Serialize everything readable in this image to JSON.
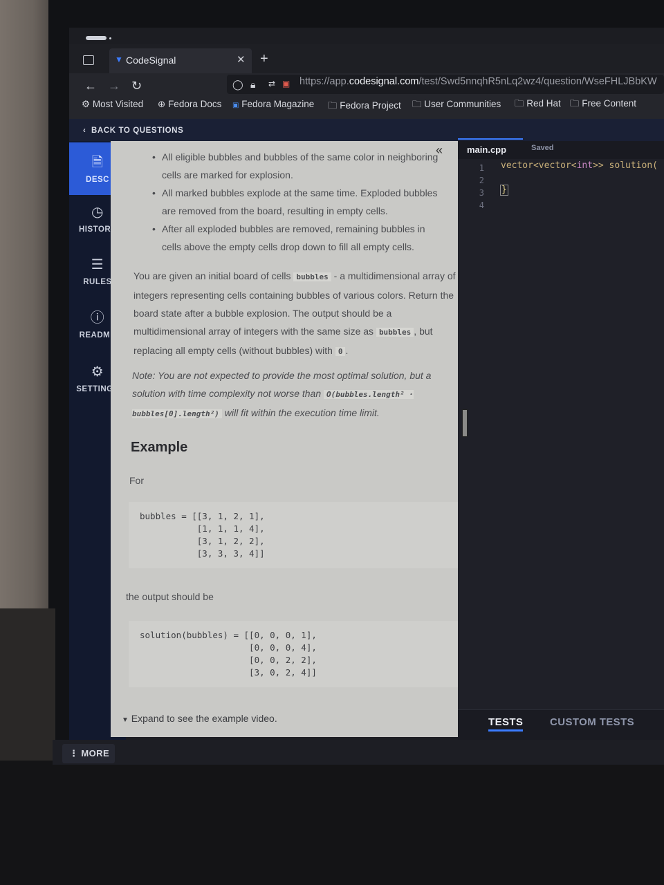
{
  "browser": {
    "tab_title": "CodeSignal",
    "url": {
      "prefix": "https://app.",
      "domain": "codesignal.com",
      "path": "/test/Swd5nnqhR5nLq2wz4/question/WseFHLJBbKW"
    },
    "bookmarks": [
      "Most Visited",
      "Fedora Docs",
      "Fedora Magazine",
      "Fedora Project",
      "User Communities",
      "Red Hat",
      "Free Content"
    ]
  },
  "app": {
    "back_label": "BACK TO QUESTIONS",
    "nav": {
      "desc": "DESC",
      "history": "HISTORY",
      "rules": "RULES",
      "readme": "README",
      "settings": "SETTINGS"
    },
    "more_label": "MORE"
  },
  "description": {
    "bullets": [
      "All eligible bubbles and bubbles of the same color in neighboring cells are marked for explosion.",
      "All marked bubbles explode at the same time. Exploded bubbles are removed from the board, resulting in empty cells.",
      "After all exploded bubbles are removed, remaining bubbles in cells above the empty cells drop down to fill all empty cells."
    ],
    "given": {
      "t1": "You are given an initial board of cells ",
      "code1": "bubbles",
      "t2": " - a multidimensional array of integers representing cells containing bubbles of various colors. Return the board state after a bubble explosion. The output should be a multidimensional array of integers with the same size as ",
      "code2": "bubbles",
      "t3": ", but replacing all empty cells (without bubbles) with ",
      "code3": "0",
      "t4": "."
    },
    "note": {
      "t1": "Note: You are not expected to provide the most optimal solution, but a solution with time complexity not worse than ",
      "code1": "O(bubbles.length² · bubbles[0].length²)",
      "t2": " will fit within the execution time limit."
    },
    "example_heading": "Example",
    "for_label": "For",
    "input_block": "bubbles = [[3, 1, 2, 1],\n           [1, 1, 1, 4],\n           [3, 1, 2, 2],\n           [3, 3, 3, 4]]",
    "output_label": "the output should be",
    "output_block": "solution(bubbles) = [[0, 0, 0, 1],\n                     [0, 0, 0, 4],\n                     [0, 0, 2, 2],\n                     [3, 0, 2, 4]]",
    "expand_label": "Expand to see the example video."
  },
  "editor": {
    "file_name": "main.cpp",
    "status": "Saved",
    "line_numbers": "1\n2\n3\n4",
    "line1_type": "vector<vector<",
    "line1_int": "int",
    "line1_rest": ">> solution(",
    "line3": "}"
  },
  "tests": {
    "tab_tests": "TESTS",
    "tab_custom": "CUSTOM TESTS"
  }
}
